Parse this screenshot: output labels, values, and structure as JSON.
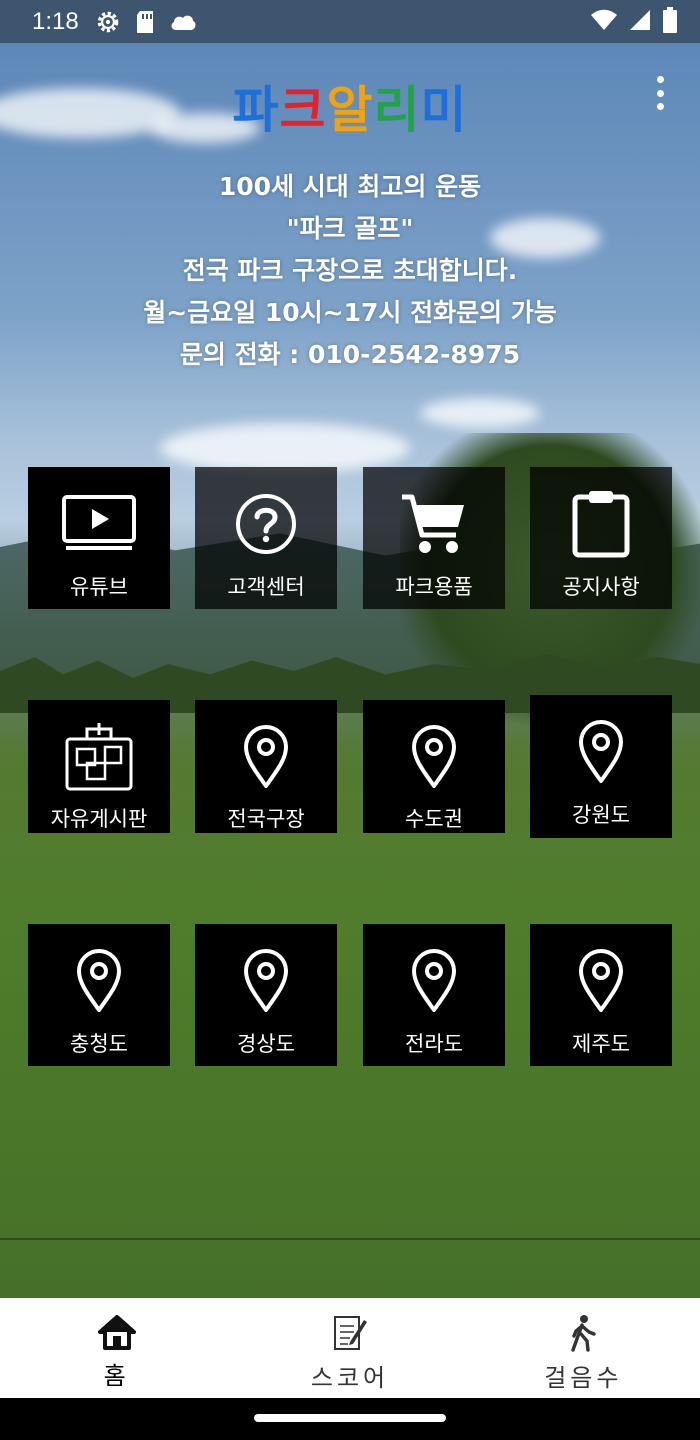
{
  "status_bar": {
    "time": "1:18",
    "icons_left": [
      "gear-icon",
      "sd-card-icon",
      "cloud-icon"
    ],
    "icons_right": [
      "wifi-icon",
      "signal-icon",
      "battery-icon"
    ]
  },
  "header": {
    "title_chars": [
      {
        "char": "파",
        "color": "#1e6fd9"
      },
      {
        "char": "크",
        "color": "#e5222c"
      },
      {
        "char": "알",
        "color": "#f2a20c"
      },
      {
        "char": "리",
        "color": "#22a34a"
      },
      {
        "char": "미",
        "color": "#1e6fd9"
      }
    ],
    "menu_icon": "more-vert-icon"
  },
  "intro": {
    "lines": [
      "100세 시대 최고의 운동",
      "\"파크 골프\"",
      "전국 파크 구장으로 초대합니다.",
      "월~금요일 10시~17시 전화문의 가능",
      "문의 전화 : 010-2542-8975"
    ]
  },
  "menu": {
    "row1": [
      {
        "label": "유튜브",
        "icon": "tv-play-icon"
      },
      {
        "label": "고객센터",
        "icon": "help-circle-icon"
      },
      {
        "label": "파크용품",
        "icon": "cart-icon"
      },
      {
        "label": "공지사항",
        "icon": "clipboard-icon"
      }
    ],
    "row2": [
      {
        "label": "자유게시판",
        "icon": "bulletin-board-icon"
      },
      {
        "label": "전국구장",
        "icon": "map-pin-icon"
      },
      {
        "label": "수도권",
        "icon": "map-pin-icon"
      },
      {
        "label": "강원도",
        "icon": "map-pin-icon"
      }
    ],
    "row3": [
      {
        "label": "충청도",
        "icon": "map-pin-icon"
      },
      {
        "label": "경상도",
        "icon": "map-pin-icon"
      },
      {
        "label": "전라도",
        "icon": "map-pin-icon"
      },
      {
        "label": "제주도",
        "icon": "map-pin-icon"
      }
    ]
  },
  "bottom_nav": {
    "items": [
      {
        "label": "홈",
        "icon": "home-icon",
        "active": true
      },
      {
        "label": "스코어",
        "icon": "score-sheet-icon",
        "active": false
      },
      {
        "label": "걸음수",
        "icon": "walking-icon",
        "active": false
      }
    ]
  }
}
